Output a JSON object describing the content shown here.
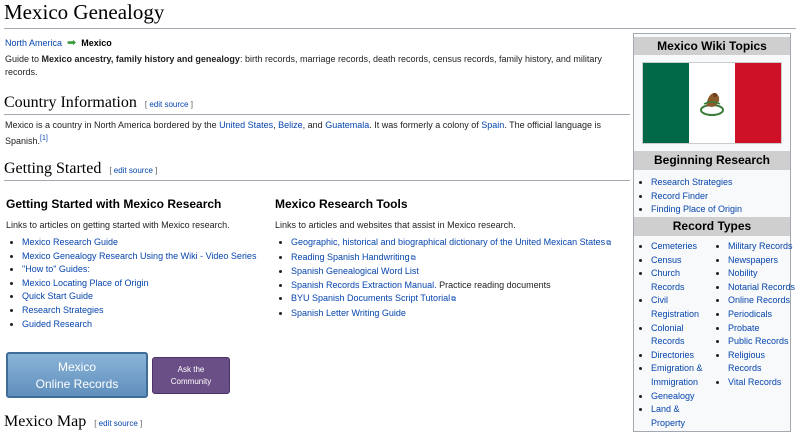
{
  "page_title": "Mexico Genealogy",
  "breadcrumb": {
    "parent": "North America",
    "current": "Mexico"
  },
  "intro": {
    "prefix": "Guide to ",
    "bold": "Mexico ancestry, family history and genealogy",
    "suffix": ": birth records, marriage records, death records, census records, family history, and military records."
  },
  "edit_label": "edit source",
  "country_info": {
    "heading": "Country Information",
    "text_1": "Mexico is a country in North America bordered by the ",
    "link_1": "United States",
    "text_2": ", ",
    "link_2": "Belize",
    "text_3": ", and ",
    "link_3": "Guatemala",
    "text_4": ". It was formerly a colony of ",
    "link_4": "Spain",
    "text_5": ". The official language is Spanish.",
    "footnote": "[1]"
  },
  "getting_started": {
    "heading": "Getting Started",
    "left": {
      "title": "Getting Started with Mexico Research",
      "desc": "Links to articles on getting started with Mexico research.",
      "items": [
        "Mexico Research Guide",
        "Mexico Genealogy Research Using the Wiki - Video Series",
        "\"How to\" Guides:",
        "Mexico Locating Place of Origin",
        "Quick Start Guide",
        "Research Strategies",
        "Guided Research"
      ]
    },
    "right": {
      "title": "Mexico Research Tools",
      "desc": "Links to articles and websites that assist in Mexico research.",
      "items": [
        "Geographic, historical and biographical dictionary of the United Mexican States",
        "Reading Spanish Handwriting",
        "Spanish Genealogical Word List",
        "Spanish Records Extraction Manual.",
        "BYU Spanish Documents Script Tutorial",
        "Spanish Letter Writing Guide"
      ],
      "item_4_suffix": " Practice reading documents"
    }
  },
  "buttons": {
    "records_line1": "Mexico",
    "records_line2": "Online Records",
    "community_line1": "Ask the",
    "community_line2": "Community"
  },
  "map_heading": "Mexico Map",
  "sidebar": {
    "topics_title": "Mexico Wiki Topics",
    "beginning_title": "Beginning Research",
    "beginning_items": [
      "Research Strategies",
      "Record Finder",
      "Finding Place of Origin"
    ],
    "record_types_title": "Record Types",
    "record_types_left": [
      "Cemeteries",
      "Census",
      "Church Records",
      "Civil Registration",
      "Colonial Records",
      "Directories",
      "Emigration & Immigration",
      "Genealogy",
      "Land & Property"
    ],
    "record_types_right": [
      "Military Records",
      "Newspapers",
      "Nobility",
      "Notarial Records",
      "Online Records",
      "Periodicals",
      "Probate",
      "Public Records",
      "Religious Records",
      "Vital Records"
    ]
  },
  "colors": {
    "link": "#0645ad",
    "flag_green": "#006847",
    "flag_red": "#ce1126",
    "button_blue": "#5f8fbc",
    "button_purple": "#6a4f86"
  }
}
